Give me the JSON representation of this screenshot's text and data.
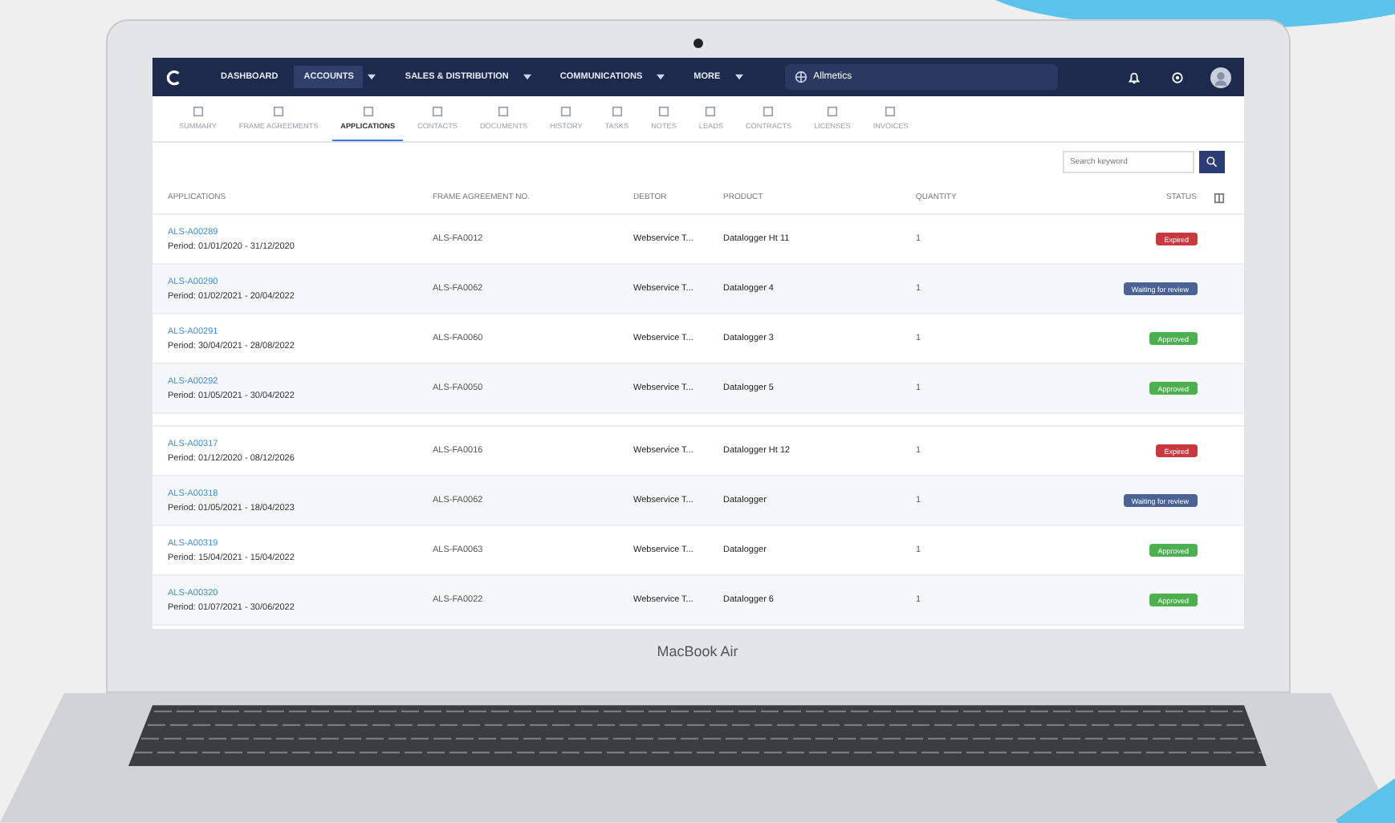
{
  "nav": {
    "items": [
      {
        "label": "DASHBOARD",
        "selected": false,
        "dropdown": false
      },
      {
        "label": "ACCOUNTS",
        "selected": true,
        "dropdown": true
      },
      {
        "label": "SALES & DISTRIBUTION",
        "selected": false,
        "dropdown": true
      },
      {
        "label": "COMMUNICATIONS",
        "selected": false,
        "dropdown": true
      },
      {
        "label": "MORE",
        "selected": false,
        "dropdown": true
      }
    ],
    "organization": "Allmetics"
  },
  "subtabs": [
    {
      "label": "SUMMARY",
      "selected": false
    },
    {
      "label": "FRAME AGREEMENTS",
      "selected": false
    },
    {
      "label": "APPLICATIONS",
      "selected": true
    },
    {
      "label": "CONTACTS",
      "selected": false
    },
    {
      "label": "DOCUMENTS",
      "selected": false
    },
    {
      "label": "HISTORY",
      "selected": false
    },
    {
      "label": "TASKS",
      "selected": false
    },
    {
      "label": "NOTES",
      "selected": false
    },
    {
      "label": "LEADS",
      "selected": false
    },
    {
      "label": "CONTRACTS",
      "selected": false
    },
    {
      "label": "LICENSES",
      "selected": false
    },
    {
      "label": "INVOICES",
      "selected": false
    }
  ],
  "search": {
    "placeholder": "Search keyword"
  },
  "table": {
    "columns": [
      "APPLICATIONS",
      "FRAME AGREEMENT NO.",
      "DEBTOR",
      "PRODUCT",
      "QUANTITY",
      "STATUS"
    ],
    "rows": [
      {
        "id": "ALS-A00289",
        "period": "Period: 01/01/2020 - 31/12/2020",
        "agreement": "ALS-FA0012",
        "debtor": "Webservice T...",
        "product": "Datalogger Ht 11",
        "quantity": "1",
        "status": "Expired",
        "kind": "expired"
      },
      {
        "id": "ALS-A00290",
        "period": "Period: 01/02/2021 - 20/04/2022",
        "agreement": "ALS-FA0062",
        "debtor": "Webservice T...",
        "product": "Datalogger 4",
        "quantity": "1",
        "status": "Waiting for review",
        "kind": "review"
      },
      {
        "id": "ALS-A00291",
        "period": "Period: 30/04/2021 - 28/08/2022",
        "agreement": "ALS-FA0060",
        "debtor": "Webservice T...",
        "product": "Datalogger 3",
        "quantity": "1",
        "status": "Approved",
        "kind": "approved"
      },
      {
        "id": "ALS-A00292",
        "period": "Period: 01/05/2021 - 30/04/2022",
        "agreement": "ALS-FA0050",
        "debtor": "Webservice T...",
        "product": "Datalogger 5",
        "quantity": "1",
        "status": "Approved",
        "kind": "approved"
      },
      {
        "id": "ALS-A00317",
        "period": "Period: 01/12/2020 - 08/12/2026",
        "agreement": "ALS-FA0016",
        "debtor": "Webservice T...",
        "product": "Datalogger Ht 12",
        "quantity": "1",
        "status": "Expired",
        "kind": "expired"
      },
      {
        "id": "ALS-A00318",
        "period": "Period: 01/05/2021 - 18/04/2023",
        "agreement": "ALS-FA0062",
        "debtor": "Webservice T...",
        "product": "Datalogger",
        "quantity": "1",
        "status": "Waiting for review",
        "kind": "review"
      },
      {
        "id": "ALS-A00319",
        "period": "Period: 15/04/2021 - 15/04/2022",
        "agreement": "ALS-FA0063",
        "debtor": "Webservice T...",
        "product": "Datalogger",
        "quantity": "1",
        "status": "Approved",
        "kind": "approved"
      },
      {
        "id": "ALS-A00320",
        "period": "Period: 01/07/2021 - 30/06/2022",
        "agreement": "ALS-FA0022",
        "debtor": "Webservice T...",
        "product": "Datalogger 6",
        "quantity": "1",
        "status": "Approved",
        "kind": "approved"
      }
    ]
  },
  "laptop_label": "MacBook Air"
}
